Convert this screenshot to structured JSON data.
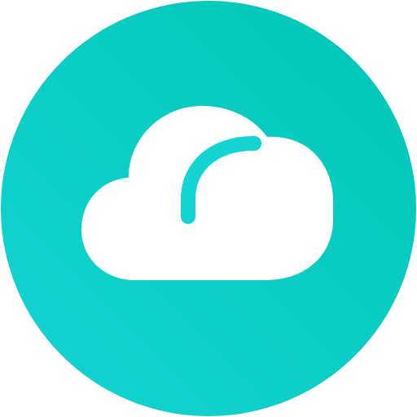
{
  "icon": {
    "name": "cloud-icon",
    "badge_shape": "circle",
    "colors": {
      "gradient_start": "#14d3d3",
      "gradient_end": "#00c7b6",
      "cloud": "#ffffff",
      "page_background": "#ffffff"
    }
  }
}
